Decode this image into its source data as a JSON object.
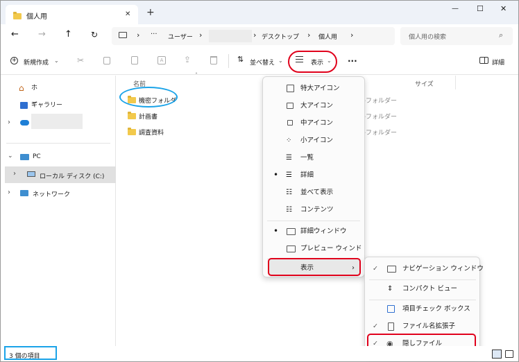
{
  "tab": {
    "title": "個人用",
    "close": "✕",
    "new_tab": "+"
  },
  "window": {
    "minimize": "—",
    "maximize": "☐",
    "close": "✕"
  },
  "address": {
    "ellipsis": "···",
    "segments": [
      "ユーザー",
      "デスクトップ",
      "個人用"
    ],
    "sep": "›",
    "search_placeholder": "個人用の検索"
  },
  "toolbar": {
    "new_label": "新規作成",
    "sort_label": "並べ替え",
    "view_label": "表示",
    "more": "···",
    "details_label": "詳細"
  },
  "nav": {
    "home": "ホーム",
    "gallery": "ギャラリー",
    "pc": "PC",
    "local_disk": "ローカル ディスク (C:)",
    "network": "ネットワーク"
  },
  "columns": {
    "name": "名前",
    "size": "サイズ"
  },
  "files": [
    {
      "name": "機密フォルダ",
      "type": "ルフォルダー"
    },
    {
      "name": "計画書",
      "type": "ルフォルダー"
    },
    {
      "name": "調査資料",
      "type": "ルフォルダー"
    }
  ],
  "view_menu": {
    "items": [
      "特大アイコン",
      "大アイコン",
      "中アイコン",
      "小アイコン",
      "一覧",
      "詳細",
      "並べて表示",
      "コンテンツ"
    ],
    "pane_items": [
      "詳細ウィンドウ",
      "プレビュー ウィンドウ"
    ],
    "show_label": "表示",
    "bullet": "•"
  },
  "show_submenu": {
    "items": [
      "ナビゲーション ウィンドウ",
      "コンパクト ビュー",
      "項目チェック ボックス",
      "ファイル名拡張子",
      "隠しファイル"
    ],
    "check": "✓"
  },
  "status": {
    "count": "3 個の項目"
  },
  "colors": {
    "highlight_red": "#e0001b",
    "highlight_blue": "#1aa3e8",
    "folder": "#f2c94c",
    "accent": "#0067c0"
  }
}
